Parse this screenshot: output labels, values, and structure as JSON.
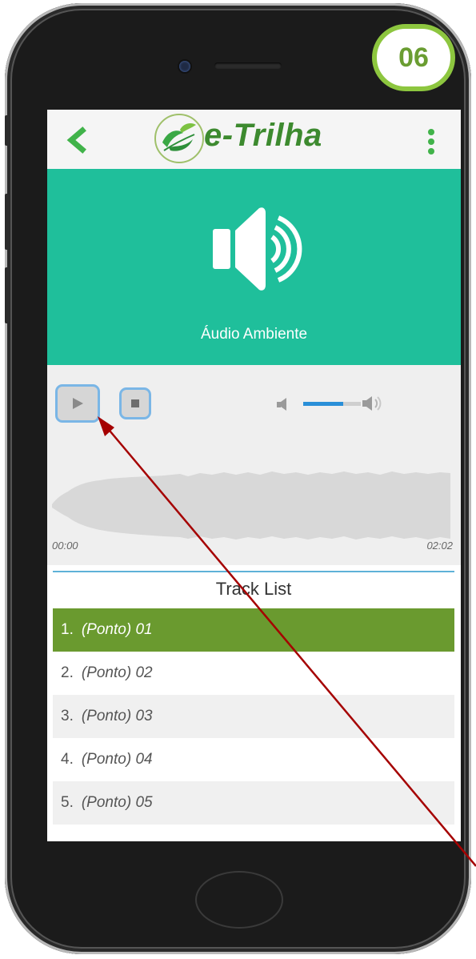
{
  "badge": {
    "number": "06"
  },
  "app": {
    "logo_text": "e-Trilha",
    "banner_title": "Áudio Ambiente",
    "accent_color": "#1fbf9b",
    "brand_green": "#3d8a2f"
  },
  "player": {
    "time_start": "00:00",
    "time_end": "02:02",
    "volume_level": 0.7,
    "play_icon": "play-icon",
    "stop_icon": "stop-icon"
  },
  "tracklist": {
    "title": "Track List",
    "tracks": [
      {
        "num": "1.",
        "name": "(Ponto) 01",
        "active": true
      },
      {
        "num": "2.",
        "name": "(Ponto) 02",
        "active": false
      },
      {
        "num": "3.",
        "name": "(Ponto) 03",
        "active": false
      },
      {
        "num": "4.",
        "name": "(Ponto) 04",
        "active": false
      },
      {
        "num": "5.",
        "name": "(Ponto) 05",
        "active": false
      }
    ]
  },
  "annotation": {
    "color": "#a50000"
  }
}
